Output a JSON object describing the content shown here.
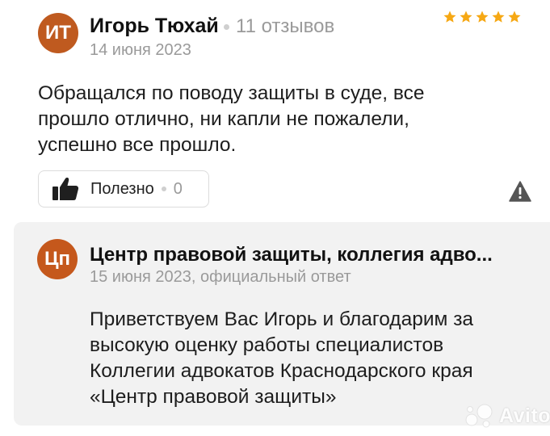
{
  "review": {
    "author_initials": "ИТ",
    "author_name": "Игорь Тюхай",
    "author_reviews": "11 отзывов",
    "date": "14 июня 2023",
    "rating": 5,
    "text": "Обращался по поводу защиты в суде, все прошло отлично, ни капли не пожалели, успешно все прошло.",
    "helpful_label": "Полезно",
    "helpful_count": "0"
  },
  "reply": {
    "org_initials": "Цп",
    "org_name": "Центр правовой защиты, коллегия адво...",
    "date": "15 июня 2023, официальный ответ",
    "text": "Приветствуем Вас Игорь и благодарим за высокую оценку работы специалистов Коллегии адвокатов Краснодарского края «Центр правовой защиты»"
  },
  "watermark": {
    "text": "Avito"
  },
  "colors": {
    "avatar": "#bf5a1f",
    "star": "#f6a814",
    "reply_bg": "#f2f2f2",
    "muted_text": "#9a9a9a"
  }
}
